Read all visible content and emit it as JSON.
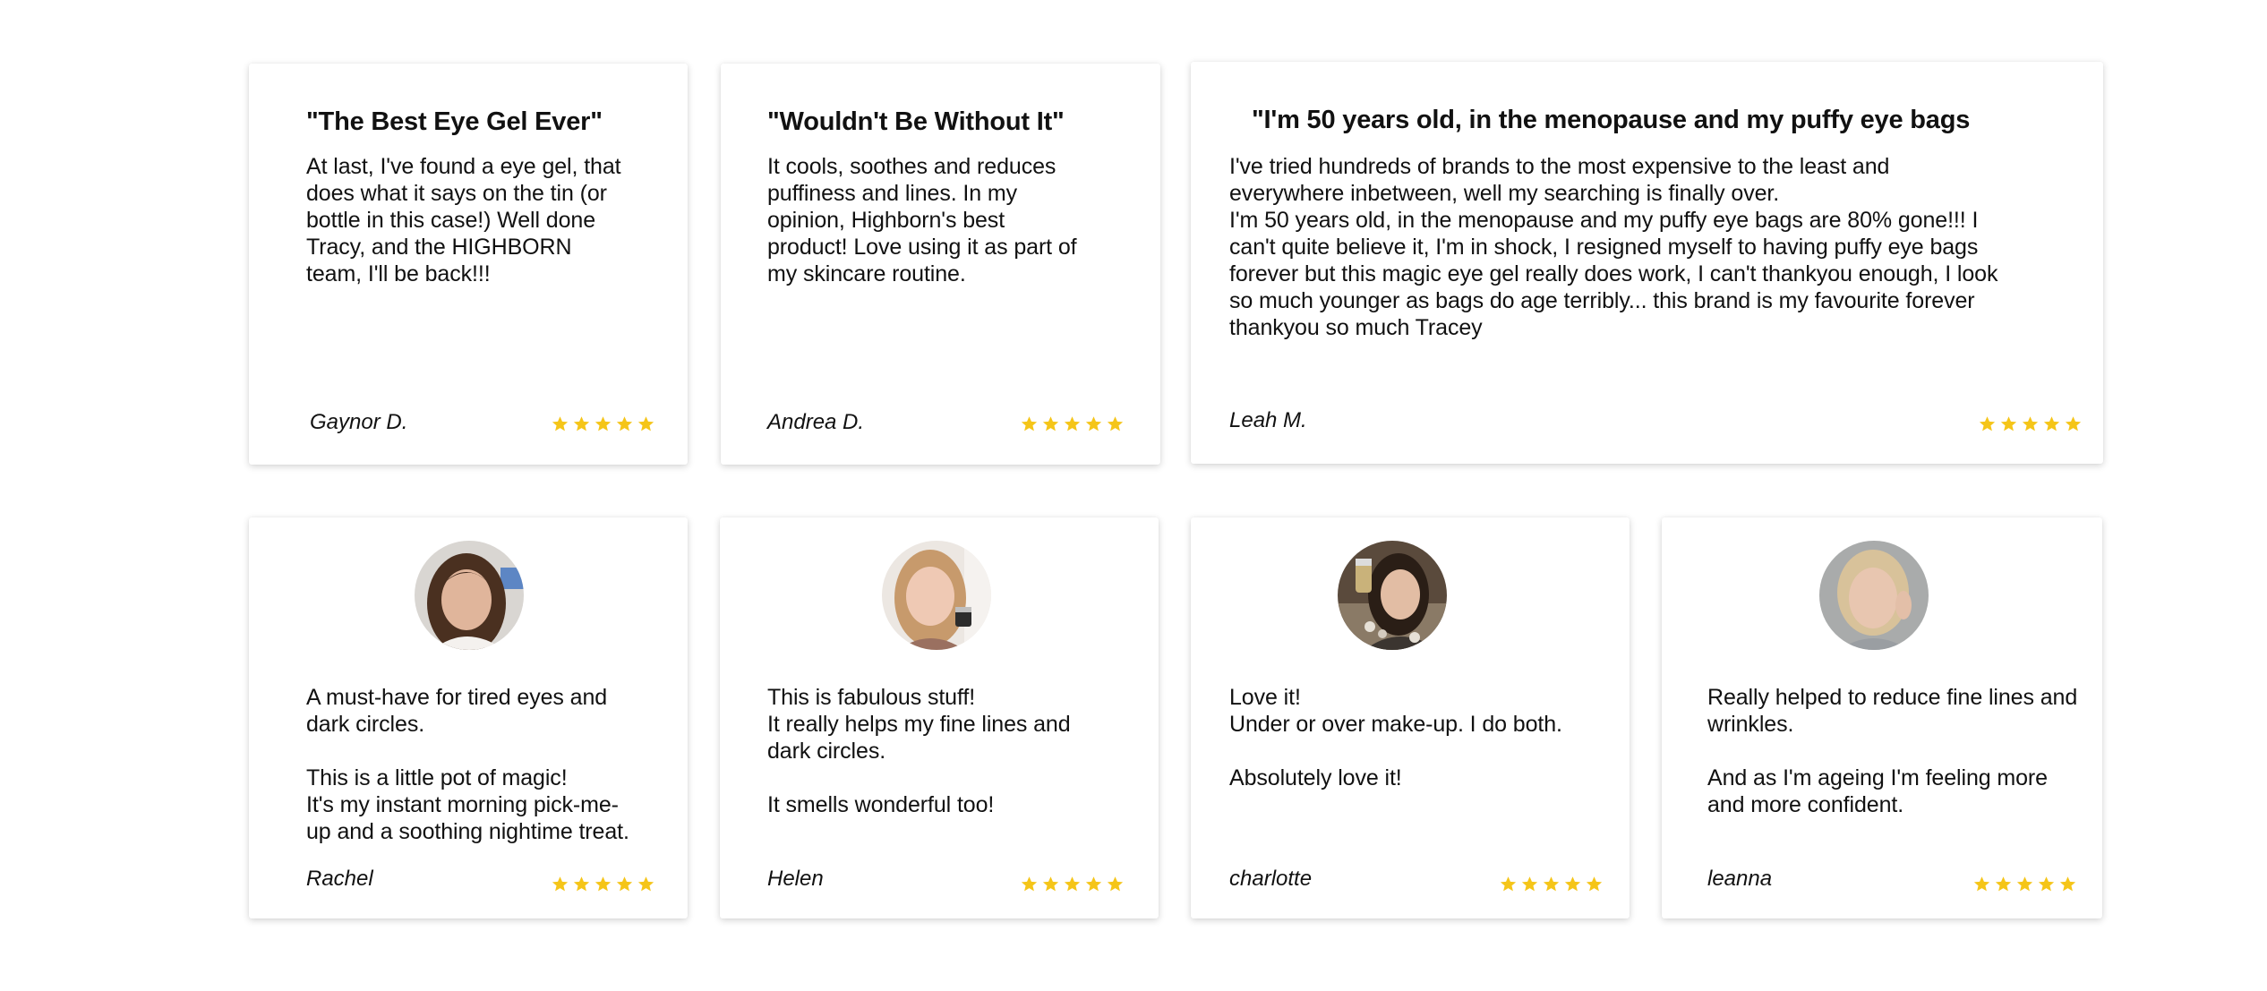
{
  "colors": {
    "star": "#f5c518",
    "text": "#111111",
    "card_bg": "#ffffff"
  },
  "top_reviews": [
    {
      "title": "\"The Best Eye Gel Ever\"",
      "body": "At last, I've found a eye gel, that\ndoes what it says on the tin (or\nbottle in this case!) Well done\nTracy, and the HIGHBORN\nteam, I'll be back!!!",
      "author": "Gaynor D.",
      "rating": 5
    },
    {
      "title": "\"Wouldn't Be Without It\"",
      "body": "It cools, soothes and reduces\npuffiness and lines. In my\nopinion, Highborn's best\nproduct! Love using it as part of\nmy skincare routine.",
      "author": "Andrea D.",
      "rating": 5
    },
    {
      "title": "\"I'm 50 years old, in the menopause and my puffy eye bags",
      "body": "I've tried hundreds of brands to the most expensive to the least and\neverywhere inbetween, well my searching is finally over.\nI'm 50 years old, in the menopause and my puffy eye bags are 80% gone!!! I\ncan't quite believe it, I'm in shock, I resigned myself to having puffy eye bags\nforever but this magic eye gel really does work, I can't thankyou enough, I look\nso much younger as bags do age terribly... this brand is my favourite forever\nthankyou so much Tracey",
      "author": "Leah M.",
      "rating": 5
    }
  ],
  "photo_reviews": [
    {
      "avatar": "avatar-rachel",
      "body": "A must-have for tired eyes and\ndark circles.\n\nThis is a little pot of magic!\nIt's my instant morning pick-me-\nup and a soothing nightime treat.",
      "author": "Rachel",
      "rating": 5
    },
    {
      "avatar": "avatar-helen",
      "body": "This is fabulous stuff!\nIt really helps my fine lines and\ndark circles.\n\nIt smells wonderful too!",
      "author": "Helen",
      "rating": 5
    },
    {
      "avatar": "avatar-charlotte",
      "body": "Love it!\nUnder or over make-up. I do both.\n\nAbsolutely love it!",
      "author": "charlotte",
      "rating": 5
    },
    {
      "avatar": "avatar-leanna",
      "body": "Really helped to reduce fine lines and\nwrinkles.\n\nAnd as I'm ageing I'm feeling more\nand more confident.",
      "author": "leanna",
      "rating": 5
    }
  ]
}
